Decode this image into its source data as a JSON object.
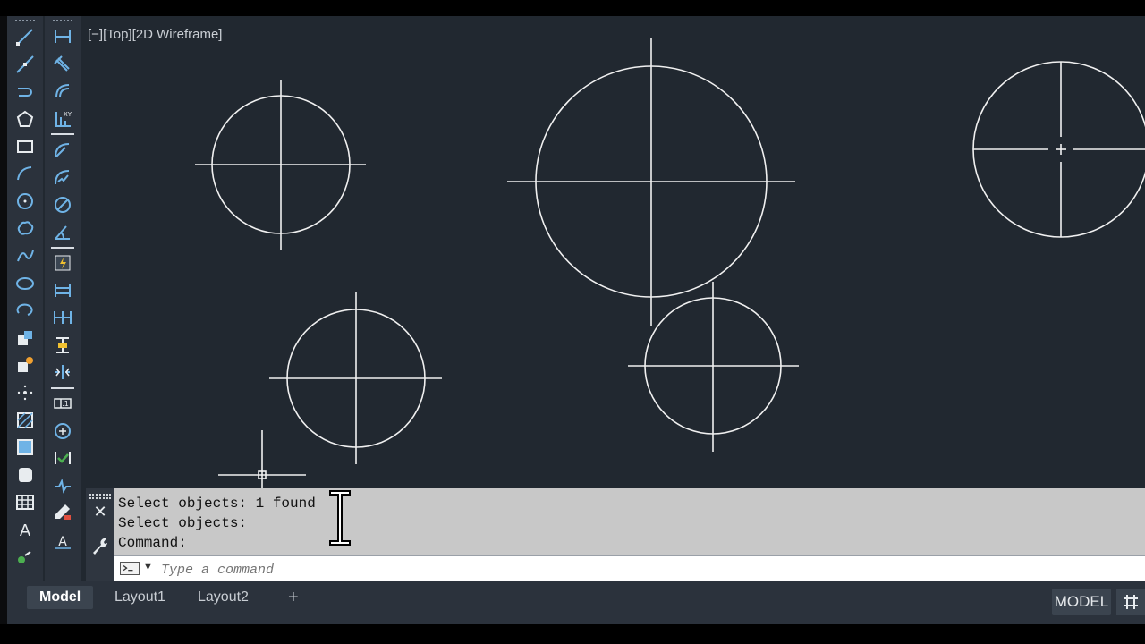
{
  "viewport": {
    "label": "[−][Top][2D Wireframe]"
  },
  "command_line": {
    "history": [
      "Select objects: 1 found",
      "Select objects:",
      "Command:"
    ],
    "placeholder": "Type a command"
  },
  "tabs": {
    "model": "Model",
    "layout1": "Layout1",
    "layout2": "Layout2",
    "add": "+"
  },
  "status": {
    "model_button": "MODEL"
  },
  "colors": {
    "canvas": "#212830",
    "toolbar": "#2b323c",
    "linework": "#f0f0f0",
    "command_history_bg": "#c8c8c8"
  },
  "toolbars": {
    "draw": [
      "line-icon",
      "construction-line-icon",
      "polyline-icon",
      "polygon-icon",
      "rectangle-icon",
      "arc-icon",
      "circle-icon",
      "revision-cloud-icon",
      "spline-icon",
      "ellipse-icon",
      "ellipse-arc-icon",
      "insert-block-icon",
      "make-block-icon",
      "point-icon",
      "hatch-icon",
      "gradient-icon",
      "region-icon",
      "table-icon",
      "multiline-text-icon",
      "add-selected-icon"
    ],
    "dimension": [
      "linear-dimension-icon",
      "aligned-dimension-icon",
      "arc-length-icon",
      "ordinate-dimension-icon",
      "radius-dimension-icon",
      "jogged-dimension-icon",
      "diameter-dimension-icon",
      "angular-dimension-icon",
      "quick-dimension-icon",
      "baseline-dimension-icon",
      "continue-dimension-icon",
      "dimension-space-icon",
      "dimension-break-icon",
      "tolerance-icon",
      "center-mark-icon",
      "inspection-icon",
      "jogged-linear-icon",
      "dimension-edit-icon",
      "dimension-text-edit-icon"
    ]
  }
}
